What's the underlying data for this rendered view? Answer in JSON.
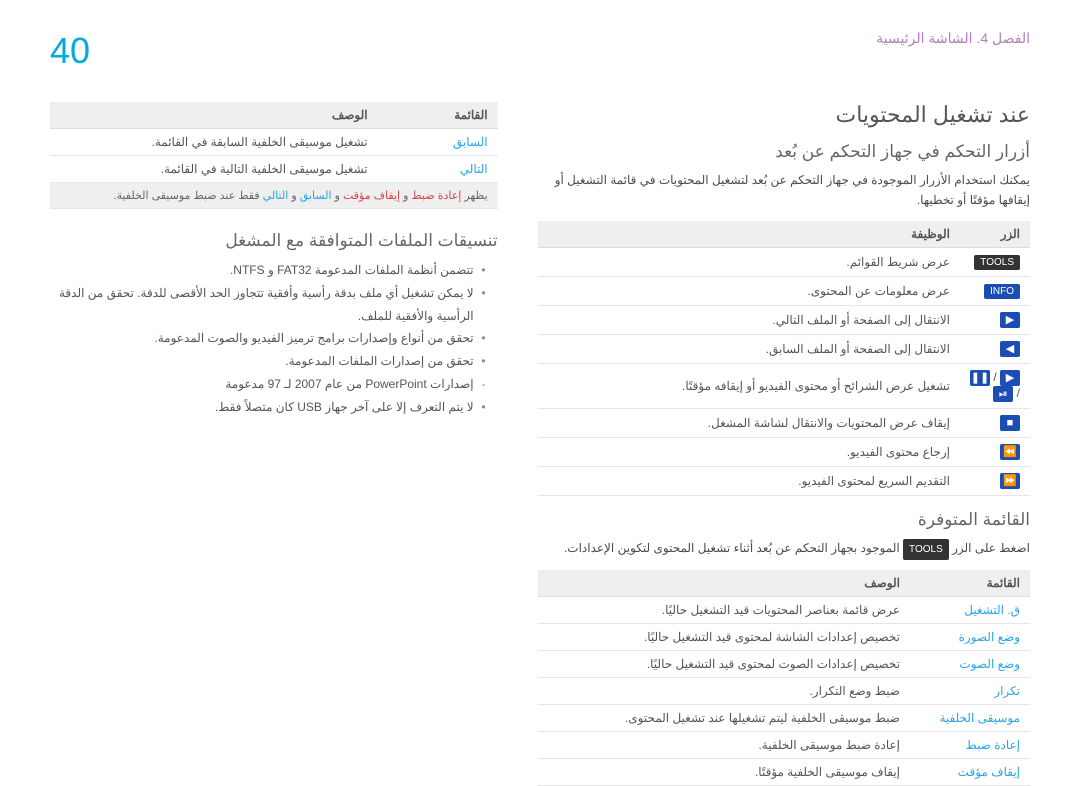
{
  "header": {
    "chapter": "الفصل 4. الشاشة الرئيسية",
    "page": "40"
  },
  "right": {
    "title": "عند تشغيل المحتويات",
    "sub1": "أزرار التحكم في جهاز التحكم عن بُعد",
    "sub1_para": "يمكنك استخدام الأزرار الموجودة في جهاز التحكم عن بُعد لتشغيل المحتويات في قائمة التشغيل أو إيقافها مؤقتًا أو تخطيها.",
    "t1": {
      "h1": "الزر",
      "h2": "الوظيفة",
      "rows": [
        {
          "icon": "TOOLS",
          "style": "black",
          "desc": "عرض شريط القوائم."
        },
        {
          "icon": "INFO",
          "style": "blue",
          "desc": "عرض معلومات عن المحتوى."
        },
        {
          "icon": "▶",
          "style": "arrow",
          "desc": "الانتقال إلى الصفحة أو الملف التالي."
        },
        {
          "icon": "◀",
          "style": "arrow",
          "desc": "الانتقال إلى الصفحة أو الملف السابق."
        },
        {
          "icon": "▶ / ❚❚ / ⏯",
          "style": "arrows",
          "desc": "تشغيل عرض الشرائح أو محتوى الفيديو أو إيقافه مؤقتًا."
        },
        {
          "icon": "■",
          "style": "arrow",
          "desc": "إيقاف عرض المحتويات والانتقال لشاشة المشغل."
        },
        {
          "icon": "⏪",
          "style": "arrow",
          "desc": "إرجاع محتوى الفيديو."
        },
        {
          "icon": "⏩",
          "style": "arrow",
          "desc": "التقديم السريع لمحتوى الفيديو."
        }
      ]
    },
    "sub2": "القائمة المتوفرة",
    "sub2_para_pre": "اضغط على الزر ",
    "sub2_para_label": "TOOLS",
    "sub2_para_post": " الموجود بجهاز التحكم عن بُعد أثناء تشغيل المحتوى لتكوين الإعدادات.",
    "t2": {
      "h1": "القائمة",
      "h2": "الوصف",
      "rows": [
        {
          "m": "ق. التشغيل",
          "d": "عرض قائمة بعناصر المحتويات قيد التشغيل حاليًا."
        },
        {
          "m": "وضع الصورة",
          "d": "تخصيص إعدادات الشاشة لمحتوى قيد التشغيل حاليًا."
        },
        {
          "m": "وضع الصوت",
          "d": "تخصيص إعدادات الصوت لمحتوى قيد التشغيل حاليًا."
        },
        {
          "m": "تكرار",
          "d": "ضبط وضع التكرار."
        },
        {
          "m": "موسيقى الخلفية",
          "d": "ضبط موسيقى الخلفية ليتم تشغيلها عند تشغيل المحتوى."
        },
        {
          "m": "إعادة ضبط",
          "d": "إعادة ضبط موسيقى الخلفية."
        },
        {
          "m": "إيقاف مؤقت",
          "d": "إيقاف موسيقى الخلفية مؤقتًا."
        }
      ]
    }
  },
  "left": {
    "t3": {
      "h1": "القائمة",
      "h2": "الوصف",
      "rows": [
        {
          "m": "السابق",
          "d": "تشغيل موسيقى الخلفية السابقة في القائمة."
        },
        {
          "m": "التالي",
          "d": "تشغيل موسيقى الخلفية التالية في القائمة."
        }
      ]
    },
    "note_pre": "يظهر ",
    "note_l1": "إعادة ضبط",
    "note_mid1": " و ",
    "note_l2": "إيقاف مؤقت",
    "note_mid2": " و ",
    "note_l3": "السابق",
    "note_mid3": " و ",
    "note_l4": "التالي",
    "note_post": " فقط عند ضبط موسيقى الخلفية.",
    "sub3": "تنسيقات الملفات المتوافقة مع المشغل",
    "bullets": [
      "تتضمن أنظمة الملفات المدعومة FAT32 و NTFS.",
      "لا يمكن تشغيل أي ملف بدقة رأسية وأفقية تتجاوز الحد الأقصى للدقة. تحقق من الدقة الرأسية والأفقية للملف.",
      "تحقق من أنواع وإصدارات برامج ترميز الفيديو والصوت المدعومة.",
      "تحقق من إصدارات الملفات المدعومة.",
      "إصدارات PowerPoint من عام 2007 لـ 97 مدعومة",
      "لا يتم التعرف إلا على آخر جهاز USB كان متصلاً فقط."
    ]
  }
}
